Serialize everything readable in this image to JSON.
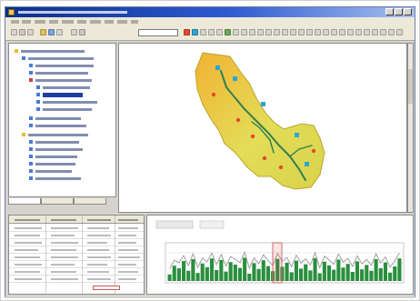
{
  "window": {
    "title": "",
    "menu": [
      "",
      "",
      "",
      "",
      "",
      "",
      "",
      "",
      "",
      ""
    ]
  },
  "toolbar": {
    "combo_value": ""
  },
  "left_panel": {
    "tabs": [
      "",
      "",
      ""
    ]
  },
  "map": {
    "watershed_fill": "#e3dd57",
    "watershed_edge": "#b9a534",
    "river": "#2f7f52",
    "stations": "#2ea6d3",
    "points": "#e24a2d"
  },
  "bottom": {
    "table": {
      "rows": 10,
      "cols": 4
    },
    "chart": {
      "bar_color": "#2a8f3e",
      "line_color": "#a0a0a0"
    }
  },
  "chart_data": {
    "type": "bar",
    "title": "",
    "xlabel": "",
    "ylabel": "",
    "ylim": [
      0,
      100
    ],
    "series": [
      {
        "values": [
          18,
          42,
          35,
          55,
          28,
          60,
          22,
          48,
          38,
          62,
          30,
          58,
          26,
          52,
          45,
          36,
          64,
          20,
          49,
          33,
          57,
          41,
          27,
          61,
          39,
          50,
          24,
          56,
          34,
          46,
          29,
          63,
          21,
          53,
          43,
          31,
          59,
          37,
          47,
          25,
          54,
          32,
          44,
          28,
          60,
          35,
          51,
          23,
          40,
          62
        ]
      }
    ]
  }
}
